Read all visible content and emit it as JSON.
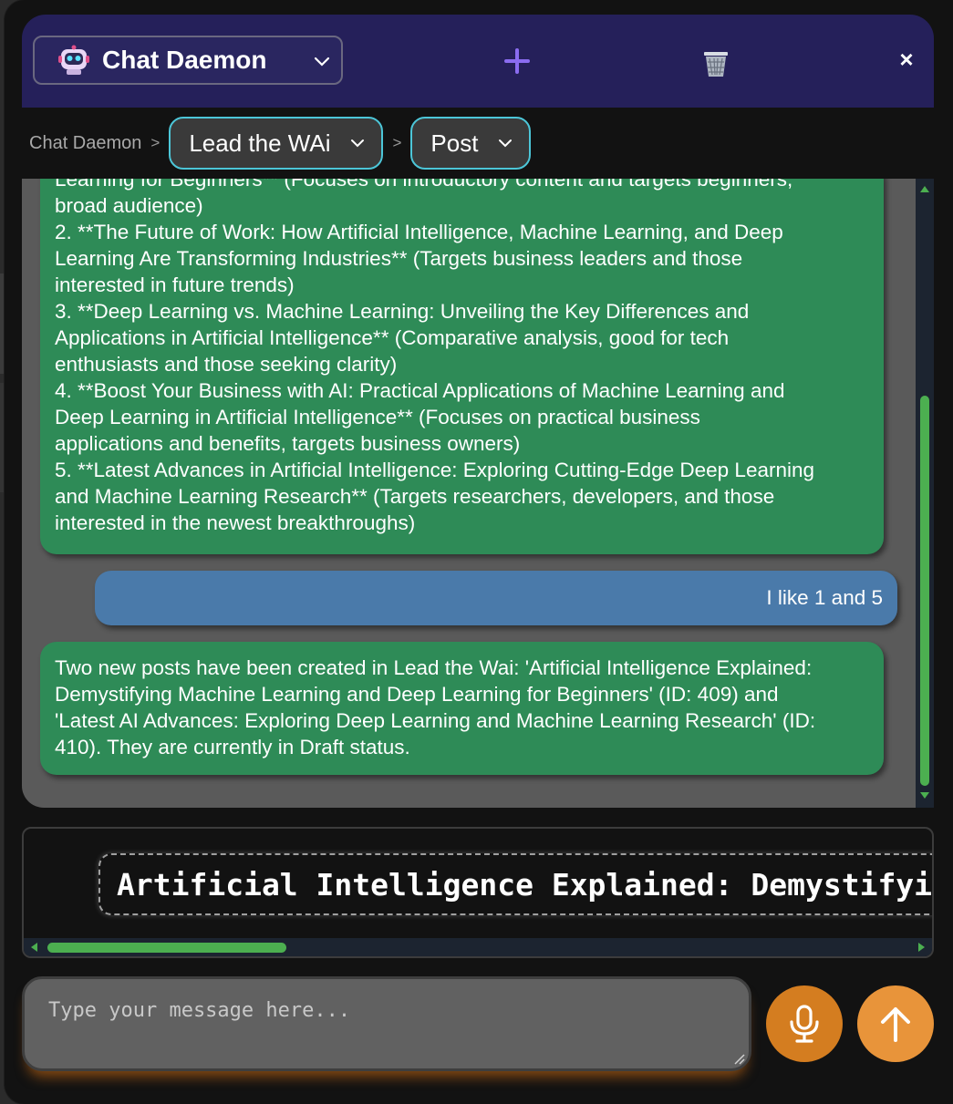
{
  "header": {
    "bot_name": "Chat Daemon",
    "new_chat_icon": "plus-icon",
    "delete_icon": "trash-icon",
    "close_label": "×"
  },
  "breadcrumb": {
    "root": "Chat Daemon",
    "separator": ">",
    "site": "Lead the WAi",
    "type": "Post"
  },
  "messages": [
    {
      "role": "bot",
      "lines": [
        "Learning for Beginners** (Focuses on introductory content and targets beginners,",
        "broad audience)",
        "2. **The Future of Work: How Artificial Intelligence, Machine Learning, and Deep",
        "Learning Are Transforming Industries** (Targets business leaders and those",
        "interested in future trends)",
        "3. **Deep Learning vs. Machine Learning: Unveiling the Key Differences and",
        "Applications in Artificial Intelligence** (Comparative analysis, good for tech",
        "enthusiasts and those seeking clarity)",
        "4. **Boost Your Business with AI: Practical Applications of Machine Learning and",
        "Deep Learning in Artificial Intelligence** (Focuses on practical business",
        "applications and benefits, targets business owners)",
        "5. **Latest Advances in Artificial Intelligence: Exploring Cutting-Edge Deep Learning",
        "and Machine Learning Research** (Targets researchers, developers, and those",
        "interested in the newest breakthroughs)"
      ]
    },
    {
      "role": "user",
      "lines": [
        "I like 1 and 5"
      ]
    },
    {
      "role": "bot",
      "lines": [
        "Two new posts have been created in Lead the Wai: 'Artificial Intelligence Explained:",
        "Demystifying Machine Learning and Deep Learning for Beginners' (ID: 409) and",
        "'Latest AI Advances: Exploring Deep Learning and Machine Learning Research' (ID:",
        "410). They are currently in Draft status."
      ]
    }
  ],
  "title_chip": "Artificial Intelligence Explained: Demystifying Machine Learning and Deep Learning for Beginners",
  "composer": {
    "placeholder": "Type your message here...",
    "mic_icon": "microphone-icon",
    "send_icon": "arrow-up-icon"
  },
  "colors": {
    "header_bg": "#25205a",
    "bot_bubble": "#2e8b57",
    "user_bubble": "#4a7aaa",
    "accent_cyan": "#4cc6d8",
    "scroll_green": "#4caf50",
    "mic_orange": "#d47d20",
    "send_orange": "#e8943a"
  }
}
